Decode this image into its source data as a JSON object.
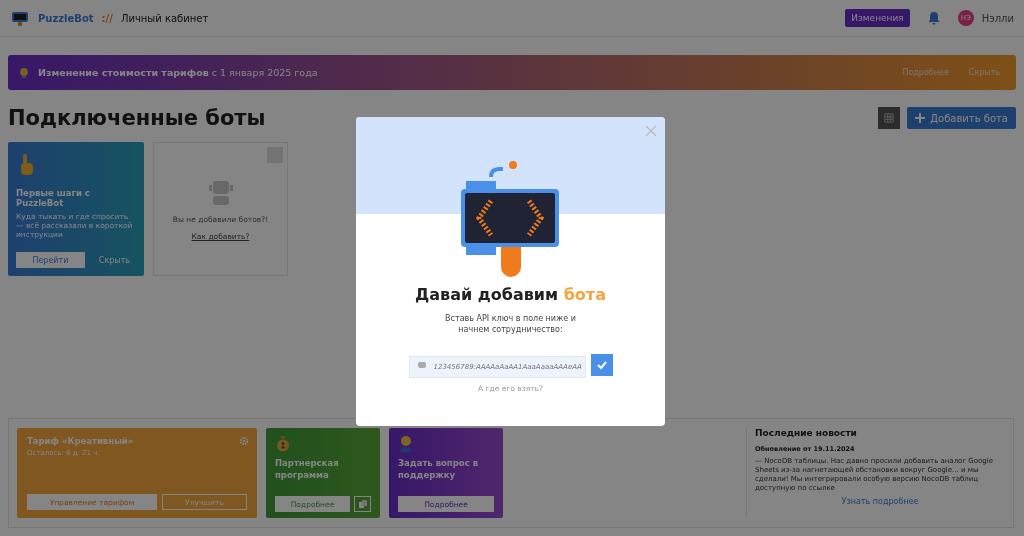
{
  "header": {
    "brand": "PuzzleBot",
    "separator": "://",
    "section": "Личный кабинет",
    "changes_button": "Изменения",
    "avatar_initials": "НЭ",
    "user_name": "Нэлли"
  },
  "banner": {
    "text": "**Изменение стоимости тарифов** с 1 января 2025 года",
    "more": "Подробнее",
    "hide": "Скрыть"
  },
  "page_title": "Подключенные боты",
  "add_bot_button": "Добавить бота",
  "start_card": {
    "title": "Первые шаги с PuzzleBot",
    "text": "Куда тыкать и где спросить — всё рассказали в короткой инструкции",
    "go": "Перейти",
    "hide": "Скрыть"
  },
  "empty_card": {
    "text": "Вы не добавили ботов?!",
    "link": "Как добавить?"
  },
  "tariff_card": {
    "title": "Тариф «Креативный»",
    "remaining": "Осталось: 6 д. 21 ч.",
    "manage": "Управление тарифом",
    "upgrade": "Улучшить"
  },
  "promo_cards": [
    {
      "kind": "partner",
      "title": "Партнерская программа",
      "button": "Подробнее"
    },
    {
      "kind": "support",
      "title": "Задать вопрос в поддержку",
      "button": "Подробнее"
    }
  ],
  "news": {
    "title": "Последние новости",
    "date": "Обновление от 19.11.2024",
    "text": "— NocoDB таблицы. Нас давно просили добавить аналог Google Sheets из-за нагнетающей обстановки вокруг Google... и мы сделали! Мы интегрировали особую версию NocoDB таблиц доступную по ссылке",
    "more": "Узнать подробнее"
  },
  "modal": {
    "title": "Давай добавим **бота**",
    "subtitle": "Вставь API ключ в поле ниже и начнем сотрудничество:",
    "placeholder": "123456789:AAAAaAaAA1AaaAaaaAAAeAA",
    "help_link": "А где его взять?"
  }
}
